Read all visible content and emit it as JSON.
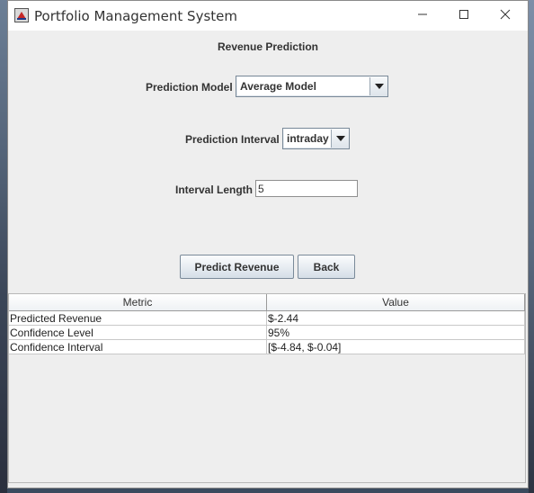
{
  "window": {
    "title": "Portfolio Management System",
    "controls": {
      "minimize": "minimize-icon",
      "maximize": "maximize-icon",
      "close": "close-icon"
    }
  },
  "form": {
    "heading": "Revenue Prediction",
    "model": {
      "label": "Prediction Model",
      "value": "Average Model"
    },
    "interval": {
      "label": "Prediction Interval",
      "value": "intraday"
    },
    "length": {
      "label": "Interval Length",
      "value": "5"
    },
    "predict_button": "Predict Revenue",
    "back_button": "Back"
  },
  "results": {
    "columns": [
      "Metric",
      "Value"
    ],
    "rows": [
      [
        "Predicted Revenue",
        "$-2.44"
      ],
      [
        "Confidence Level",
        "95%"
      ],
      [
        "Confidence Interval",
        "[$-4.84, $-0.04]"
      ]
    ]
  }
}
